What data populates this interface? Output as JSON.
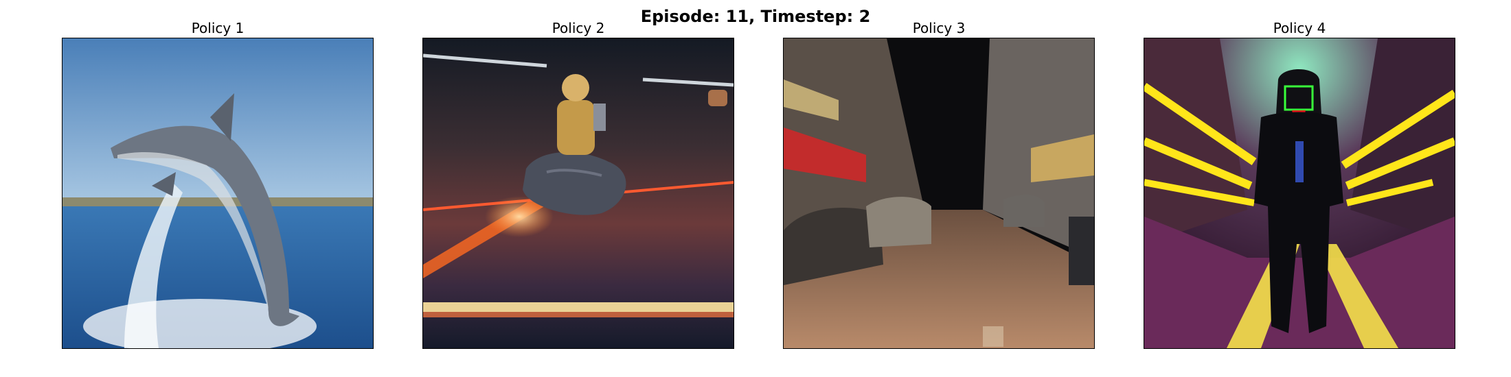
{
  "suptitle": "Episode: 11, Timestep: 2",
  "panels": [
    {
      "title": "Policy 1",
      "image": "dolphin-jumping-out-of-ocean"
    },
    {
      "title": "Policy 2",
      "image": "astronaut-riding-asteroid-in-space"
    },
    {
      "title": "Policy 3",
      "image": "city-street-at-night-with-parked-cars"
    },
    {
      "title": "Policy 4",
      "image": "hooded-figure-in-neon-alley"
    }
  ]
}
